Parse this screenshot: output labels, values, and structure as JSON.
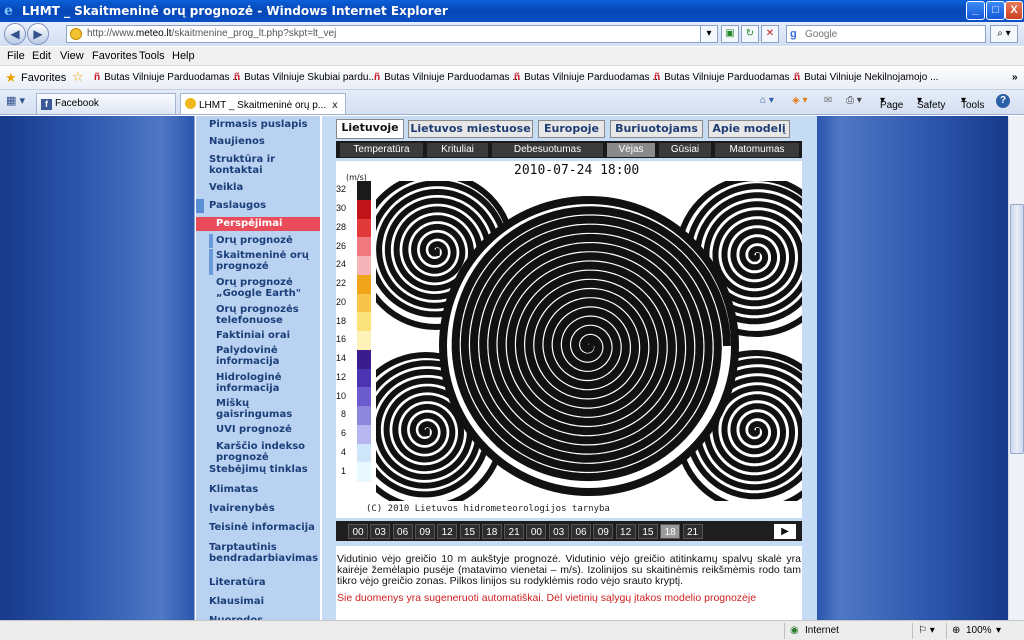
{
  "window": {
    "title": "LHMT _ Skaitmeninė orų prognozė - Windows Internet Explorer",
    "minimize": "_",
    "maximize": "□",
    "close": "X"
  },
  "address": {
    "url_prefix": "http://www.",
    "url_domain": "meteo.lt",
    "url_path": "/skaitmenine_prog_lt.php?skpt=lt_vej",
    "search_placeholder": "Google"
  },
  "menu": [
    "File",
    "Edit",
    "View",
    "Favorites",
    "Tools",
    "Help"
  ],
  "favorites": {
    "label": "Favorites",
    "items": [
      "Butas Vilniuje Parduodamas ...",
      "Butas Vilniuje Skubiai pardu...",
      "Butas Vilniuje Parduodamas ...",
      "Butas Vilniuje Parduodamas ...",
      "Butas Vilniuje Parduodamas ...",
      "Butai Vilniuje Nekilnojamojo ..."
    ]
  },
  "tabs": [
    {
      "label": "Facebook"
    },
    {
      "label": "LHMT _ Skaitmeninė orų p...",
      "close": "x"
    }
  ],
  "commandbar": {
    "page": "Page",
    "safety": "Safety",
    "tools": "Tools",
    "help": "?"
  },
  "leftnav": [
    {
      "label": "Pirmasis puslapis",
      "level": 0
    },
    {
      "label": "Naujienos",
      "level": 0
    },
    {
      "label": "Struktūra ir kontaktai",
      "level": 0
    },
    {
      "label": "Veikla",
      "level": 0
    },
    {
      "label": "Paslaugos",
      "level": 0
    },
    {
      "label": "Perspėjimai",
      "level": 1,
      "active": true
    },
    {
      "label": "Orų prognozė",
      "level": 1
    },
    {
      "label": "Skaitmeninė orų prognozė",
      "level": 1
    },
    {
      "label": "Orų prognozė „Google Earth\"",
      "level": 1
    },
    {
      "label": "Orų prognozės telefonuose",
      "level": 1
    },
    {
      "label": "Faktiniai orai",
      "level": 1
    },
    {
      "label": "Palydovinė informacija",
      "level": 1
    },
    {
      "label": "Hidrologinė informacija",
      "level": 1
    },
    {
      "label": "Miškų gaisringumas",
      "level": 1
    },
    {
      "label": "UVI prognozė",
      "level": 1
    },
    {
      "label": "Karščio indekso prognozė",
      "level": 1
    },
    {
      "label": "Stebėjimų tinklas",
      "level": 0
    },
    {
      "label": "Klimatas",
      "level": 0
    },
    {
      "label": "Įvairenybės",
      "level": 0
    },
    {
      "label": "Teisinė informacija",
      "level": 0
    },
    {
      "label": "Tarptautinis bendradarbiavimas",
      "level": 0
    },
    {
      "label": "Literatūra",
      "level": 0
    },
    {
      "label": "Klausimai",
      "level": 0
    },
    {
      "label": "Nuorodos",
      "level": 0
    }
  ],
  "region_tabs": [
    "Lietuvoje",
    "Lietuvos miestuose",
    "Europoje",
    "Buriuotojams",
    "Apie modelį"
  ],
  "param_tabs": [
    "Temperatūra",
    "Krituliai",
    "Debesuotumas",
    "Vėjas",
    "Gūsiai",
    "Matomumas"
  ],
  "map": {
    "date": "2010-07-24   18:00",
    "unit": "(m/s)",
    "legend_ticks": [
      "32",
      "30",
      "28",
      "26",
      "24",
      "22",
      "20",
      "18",
      "16",
      "14",
      "12",
      "10",
      "8",
      "6",
      "4",
      "1"
    ],
    "legend_colors": [
      "#1a1a1a",
      "#c0141a",
      "#e03a3a",
      "#f07a80",
      "#f3b3b8",
      "#f1a51a",
      "#f6c54a",
      "#f9e27a",
      "#fdf3b8",
      "#3a1c8c",
      "#4a34b4",
      "#6a5ccc",
      "#8d86dc",
      "#b7b6ee",
      "#cfe6fa",
      "#e9f7ff"
    ],
    "copyright": "(C) 2010 Lietuvos hidrometeorologijos tarnyba"
  },
  "timeline": {
    "hours": [
      "00",
      "03",
      "06",
      "09",
      "12",
      "15",
      "18",
      "21",
      "00",
      "03",
      "06",
      "09",
      "12",
      "15",
      "18",
      "21"
    ],
    "active_index": 14,
    "play": "▶"
  },
  "description": {
    "text": "Vidutinio vėjo greičio 10 m aukštyje prognozė. Vidutinio vėjo greičio atitinkamų spalvų skalė yra kairėje žemėlapio pusėje (matavimo vienetai – m/s). Izolinijos su skaitinėmis reikšmėmis rodo tam tikro vėjo greičio zonas. Pilkos linijos su rodyklėmis rodo vėjo srauto kryptį.",
    "warning": "Šie duomenys yra sugeneruoti automatiškai. Dėl vietinių sąlygų įtakos modelio prognozėje"
  },
  "status": {
    "zone": "Internet",
    "zoom": "100%"
  }
}
